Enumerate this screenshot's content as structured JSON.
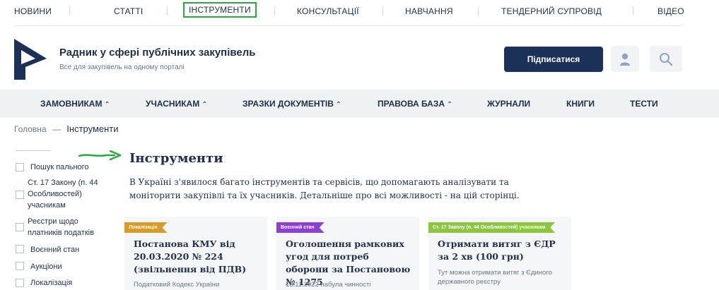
{
  "top_nav": {
    "items": [
      "НОВИНИ",
      "СТАТТІ",
      "ІНСТРУМЕНТИ",
      "КОНСУЛЬТАЦІЇ",
      "НАВЧАННЯ",
      "ТЕНДЕРНИЙ СУПРОВІД",
      "ВІДЕО"
    ],
    "active": "ІНСТРУМЕНТИ"
  },
  "header": {
    "title": "Радник у сфері публічних закупівель",
    "subtitle": "Все для закупівель на одному порталі",
    "subscribe_label": "Підписатися",
    "icons": [
      "user-icon",
      "search-icon"
    ]
  },
  "main_nav": {
    "items": [
      {
        "label": "ЗАМОВНИКАМ",
        "dropdown": true
      },
      {
        "label": "УЧАСНИКАМ",
        "dropdown": true
      },
      {
        "label": "ЗРАЗКИ ДОКУМЕНТІВ",
        "dropdown": true
      },
      {
        "label": "ПРАВОВА БАЗА",
        "dropdown": true
      },
      {
        "label": "ЖУРНАЛИ",
        "dropdown": false
      },
      {
        "label": "КНИГИ",
        "dropdown": false
      },
      {
        "label": "ТЕСТИ",
        "dropdown": false
      }
    ]
  },
  "breadcrumb": {
    "home": "Головна",
    "separator": "—",
    "current": "Інструменти"
  },
  "filters": [
    "Пошук пального",
    "Ст. 17 Закону (п. 44 Особливостей) учасникам",
    "Реєстри щодо платників податків",
    "Воєнний стан",
    "Аукціони",
    "Локалізація"
  ],
  "page": {
    "heading": "Інструменти",
    "intro": "В Україні з'явилося багато інструментів та сервісів, що допомагають аналізувати та моніторити закупівлі та їх учасників. Детальніше про всі можливості - на цій сторінці."
  },
  "cards": [
    {
      "tag": "Локалізація",
      "tag_color": "#d69a2d",
      "title": "Постанова КМУ від 20.03.2020 № 224 (звільнення від ПДВ)",
      "meta": "Податковий Кодекс України"
    },
    {
      "tag": "Воєнний стан",
      "tag_color": "#8d3fd1",
      "title": "Оголошення рамкових угод для потреб оборони за Постановою № 1275",
      "meta": "15.11.2022 набула чинності"
    },
    {
      "tag": "Ст. 17 Закону (п. 44 Особливостей) учасникам",
      "tag_color": "#8cc63f",
      "title": "Отримати витяг з ЄДР за 2 хв (100 грн)",
      "meta": "Тут можна отримати витяг з Єдиного державного реєстру"
    }
  ],
  "colors": {
    "primary": "#1b3157",
    "highlight": "#2aa844",
    "nav_bg": "#eef2f2"
  }
}
